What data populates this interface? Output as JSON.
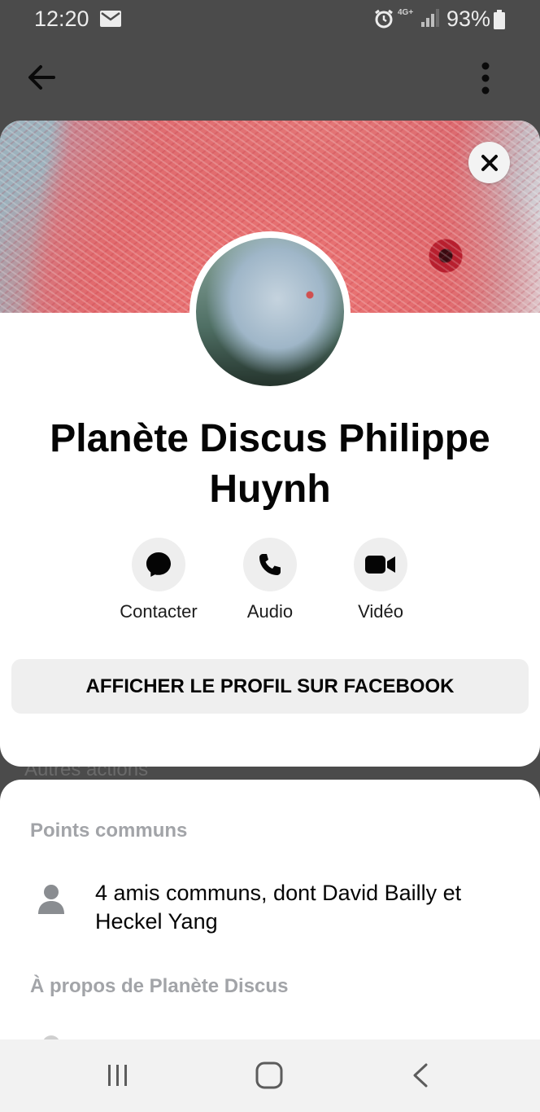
{
  "status_bar": {
    "time": "12:20",
    "network": "4G+",
    "battery": "93%",
    "icons": [
      "mail-icon",
      "alarm-icon",
      "signal-icon",
      "battery-icon"
    ]
  },
  "app_bar": {
    "icons": [
      "back-arrow-icon",
      "more-vert-icon"
    ]
  },
  "profile": {
    "name": "Planète Discus Philippe Huynh",
    "actions": [
      {
        "label": "Contacter",
        "icon": "messenger-bubble-icon"
      },
      {
        "label": "Audio",
        "icon": "phone-icon"
      },
      {
        "label": "Vidéo",
        "icon": "video-camera-icon"
      }
    ],
    "facebook_button": "AFFICHER LE PROFIL SUR FACEBOOK"
  },
  "background_peek": {
    "text": "Autres actions"
  },
  "sheet": {
    "common_header": "Points communs",
    "mutual_friends": "4 amis communs, dont David Bailly et Heckel Yang",
    "about_header": "À propos de Planète Discus"
  },
  "nav_bar": {
    "icons": [
      "recents-icon",
      "home-icon",
      "back-icon"
    ]
  },
  "colors": {
    "overlay": "#4b4b4b",
    "card": "#ffffff",
    "button_bg": "#efefef",
    "section_header": "#a2a4a8"
  }
}
